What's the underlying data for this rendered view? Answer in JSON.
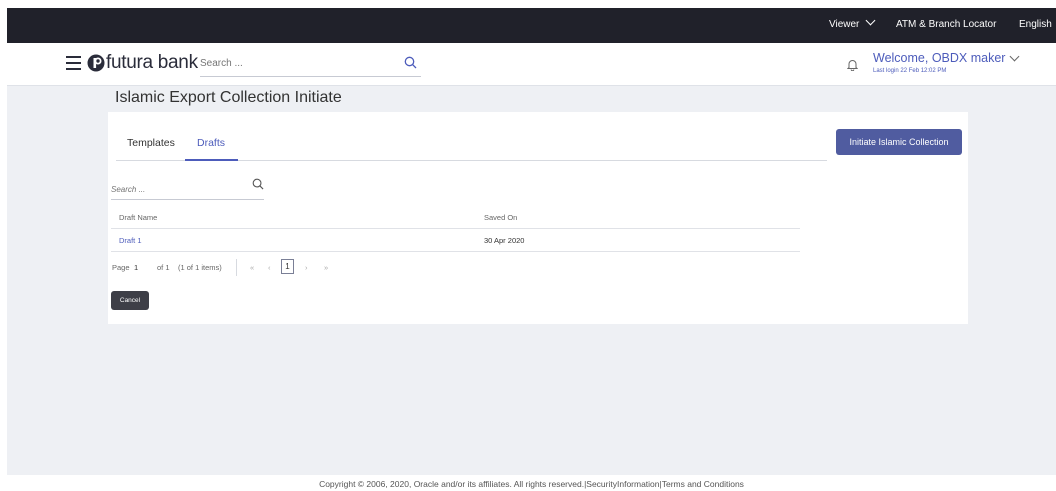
{
  "topbar": {
    "viewer_label": "Viewer",
    "atm_locator": "ATM & Branch Locator",
    "language": "English"
  },
  "header": {
    "brand_name": "futura bank",
    "search_placeholder": "Search ...",
    "welcome_text": "Welcome, OBDX maker",
    "last_login": "Last login 22 Feb 12:02 PM"
  },
  "page": {
    "title": "Islamic Export Collection Initiate"
  },
  "tabs": [
    {
      "label": "Templates",
      "active": false
    },
    {
      "label": "Drafts",
      "active": true
    }
  ],
  "actions": {
    "initiate_label": "Initiate Islamic Collection",
    "cancel_label": "Cancel"
  },
  "list": {
    "search_placeholder": "Search ...",
    "columns": [
      "Draft Name",
      "Saved On"
    ],
    "rows": [
      {
        "name": "Draft 1",
        "saved_on": "30 Apr 2020"
      }
    ]
  },
  "pagination": {
    "page_label": "Page",
    "current_page": "1",
    "of_total": "of 1",
    "items_info": "(1 of 1 items)",
    "first": "«",
    "prev": "‹",
    "next": "›",
    "last": "»"
  },
  "footer": {
    "text": "Copyright © 2006, 2020, Oracle and/or its affiliates. All rights reserved.|SecurityInformation|Terms and Conditions"
  },
  "colors": {
    "topbar_bg": "#20212a",
    "accent": "#4d5cbb",
    "primary_button": "#505ca0",
    "secondary_button": "#3e3f47",
    "page_bg": "#eef0f4"
  }
}
